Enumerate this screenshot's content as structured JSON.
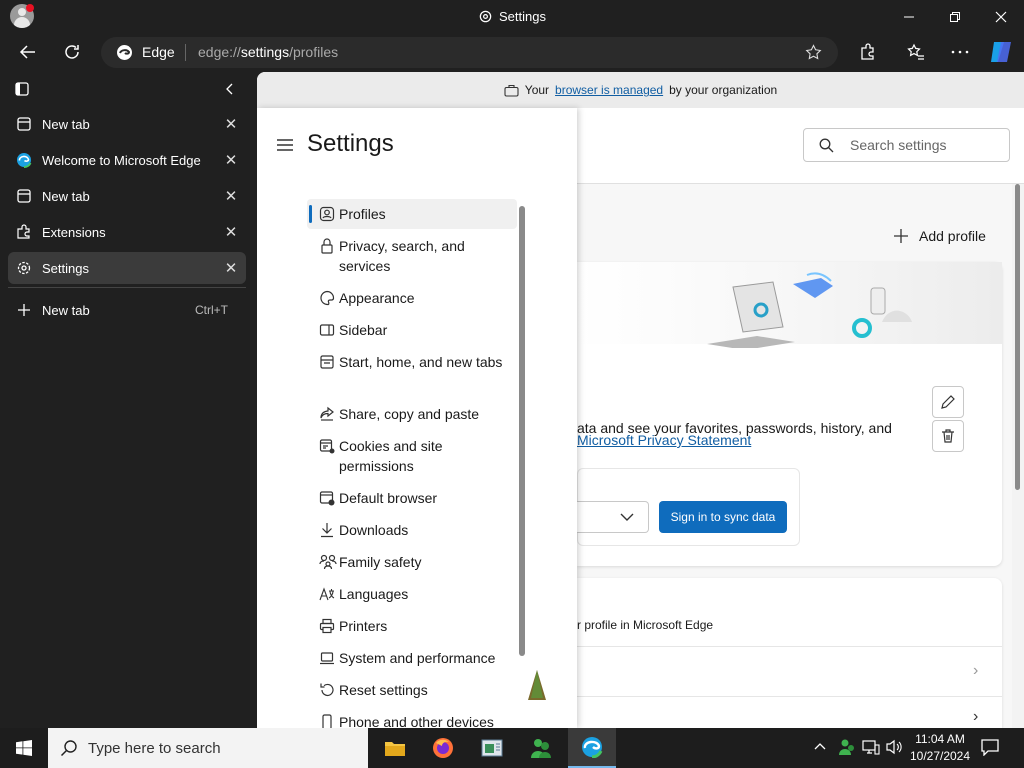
{
  "window": {
    "title": "Settings"
  },
  "toolbar": {
    "site_name": "Edge",
    "url_prefix": "edge://",
    "url_bold": "settings",
    "url_suffix": "/profiles"
  },
  "sidebar": {
    "tabs": [
      {
        "label": "New tab",
        "icon": "newtab-icon"
      },
      {
        "label": "Welcome to Microsoft Edge",
        "icon": "edge-icon"
      },
      {
        "label": "New tab",
        "icon": "newtab-icon"
      },
      {
        "label": "Extensions",
        "icon": "extensions-icon"
      },
      {
        "label": "Settings",
        "icon": "gear-icon",
        "active": true
      }
    ],
    "new_tab_label": "New tab",
    "new_tab_shortcut": "Ctrl+T"
  },
  "managed_bar": {
    "prefix": "Your",
    "link": "browser is managed",
    "suffix": "by your organization"
  },
  "settings": {
    "title": "Settings",
    "search_placeholder": "Search settings",
    "nav": [
      {
        "label": "Profiles",
        "icon": "profile-icon"
      },
      {
        "label": "Privacy, search, and services",
        "icon": "lock-icon"
      },
      {
        "label": "Appearance",
        "icon": "palette-icon"
      },
      {
        "label": "Sidebar",
        "icon": "sidebar-icon"
      },
      {
        "label": "Start, home, and new tabs",
        "icon": "home-icon"
      },
      {
        "label": "Share, copy and paste",
        "icon": "share-icon"
      },
      {
        "label": "Cookies and site permissions",
        "icon": "cookie-icon"
      },
      {
        "label": "Default browser",
        "icon": "browser-icon"
      },
      {
        "label": "Downloads",
        "icon": "download-icon"
      },
      {
        "label": "Family safety",
        "icon": "family-icon"
      },
      {
        "label": "Languages",
        "icon": "language-icon"
      },
      {
        "label": "Printers",
        "icon": "printer-icon"
      },
      {
        "label": "System and performance",
        "icon": "laptop-icon"
      },
      {
        "label": "Reset settings",
        "icon": "reset-icon"
      },
      {
        "label": "Phone and other devices",
        "icon": "phone-icon"
      }
    ]
  },
  "profile": {
    "add_profile": "Add profile",
    "sync_text": "ata and see your favorites, passwords, history, and",
    "privacy_link": "Microsoft Privacy Statement",
    "sign_in_button": "Sign in to sync data",
    "profile_line": "r profile in Microsoft Edge"
  },
  "taskbar": {
    "search_placeholder": "Type here to search",
    "time": "11:04 AM",
    "date": "10/27/2024"
  },
  "colors": {
    "accent": "#0f6cbd",
    "dark": "#202020",
    "active_tab": "#3b3b3b"
  }
}
